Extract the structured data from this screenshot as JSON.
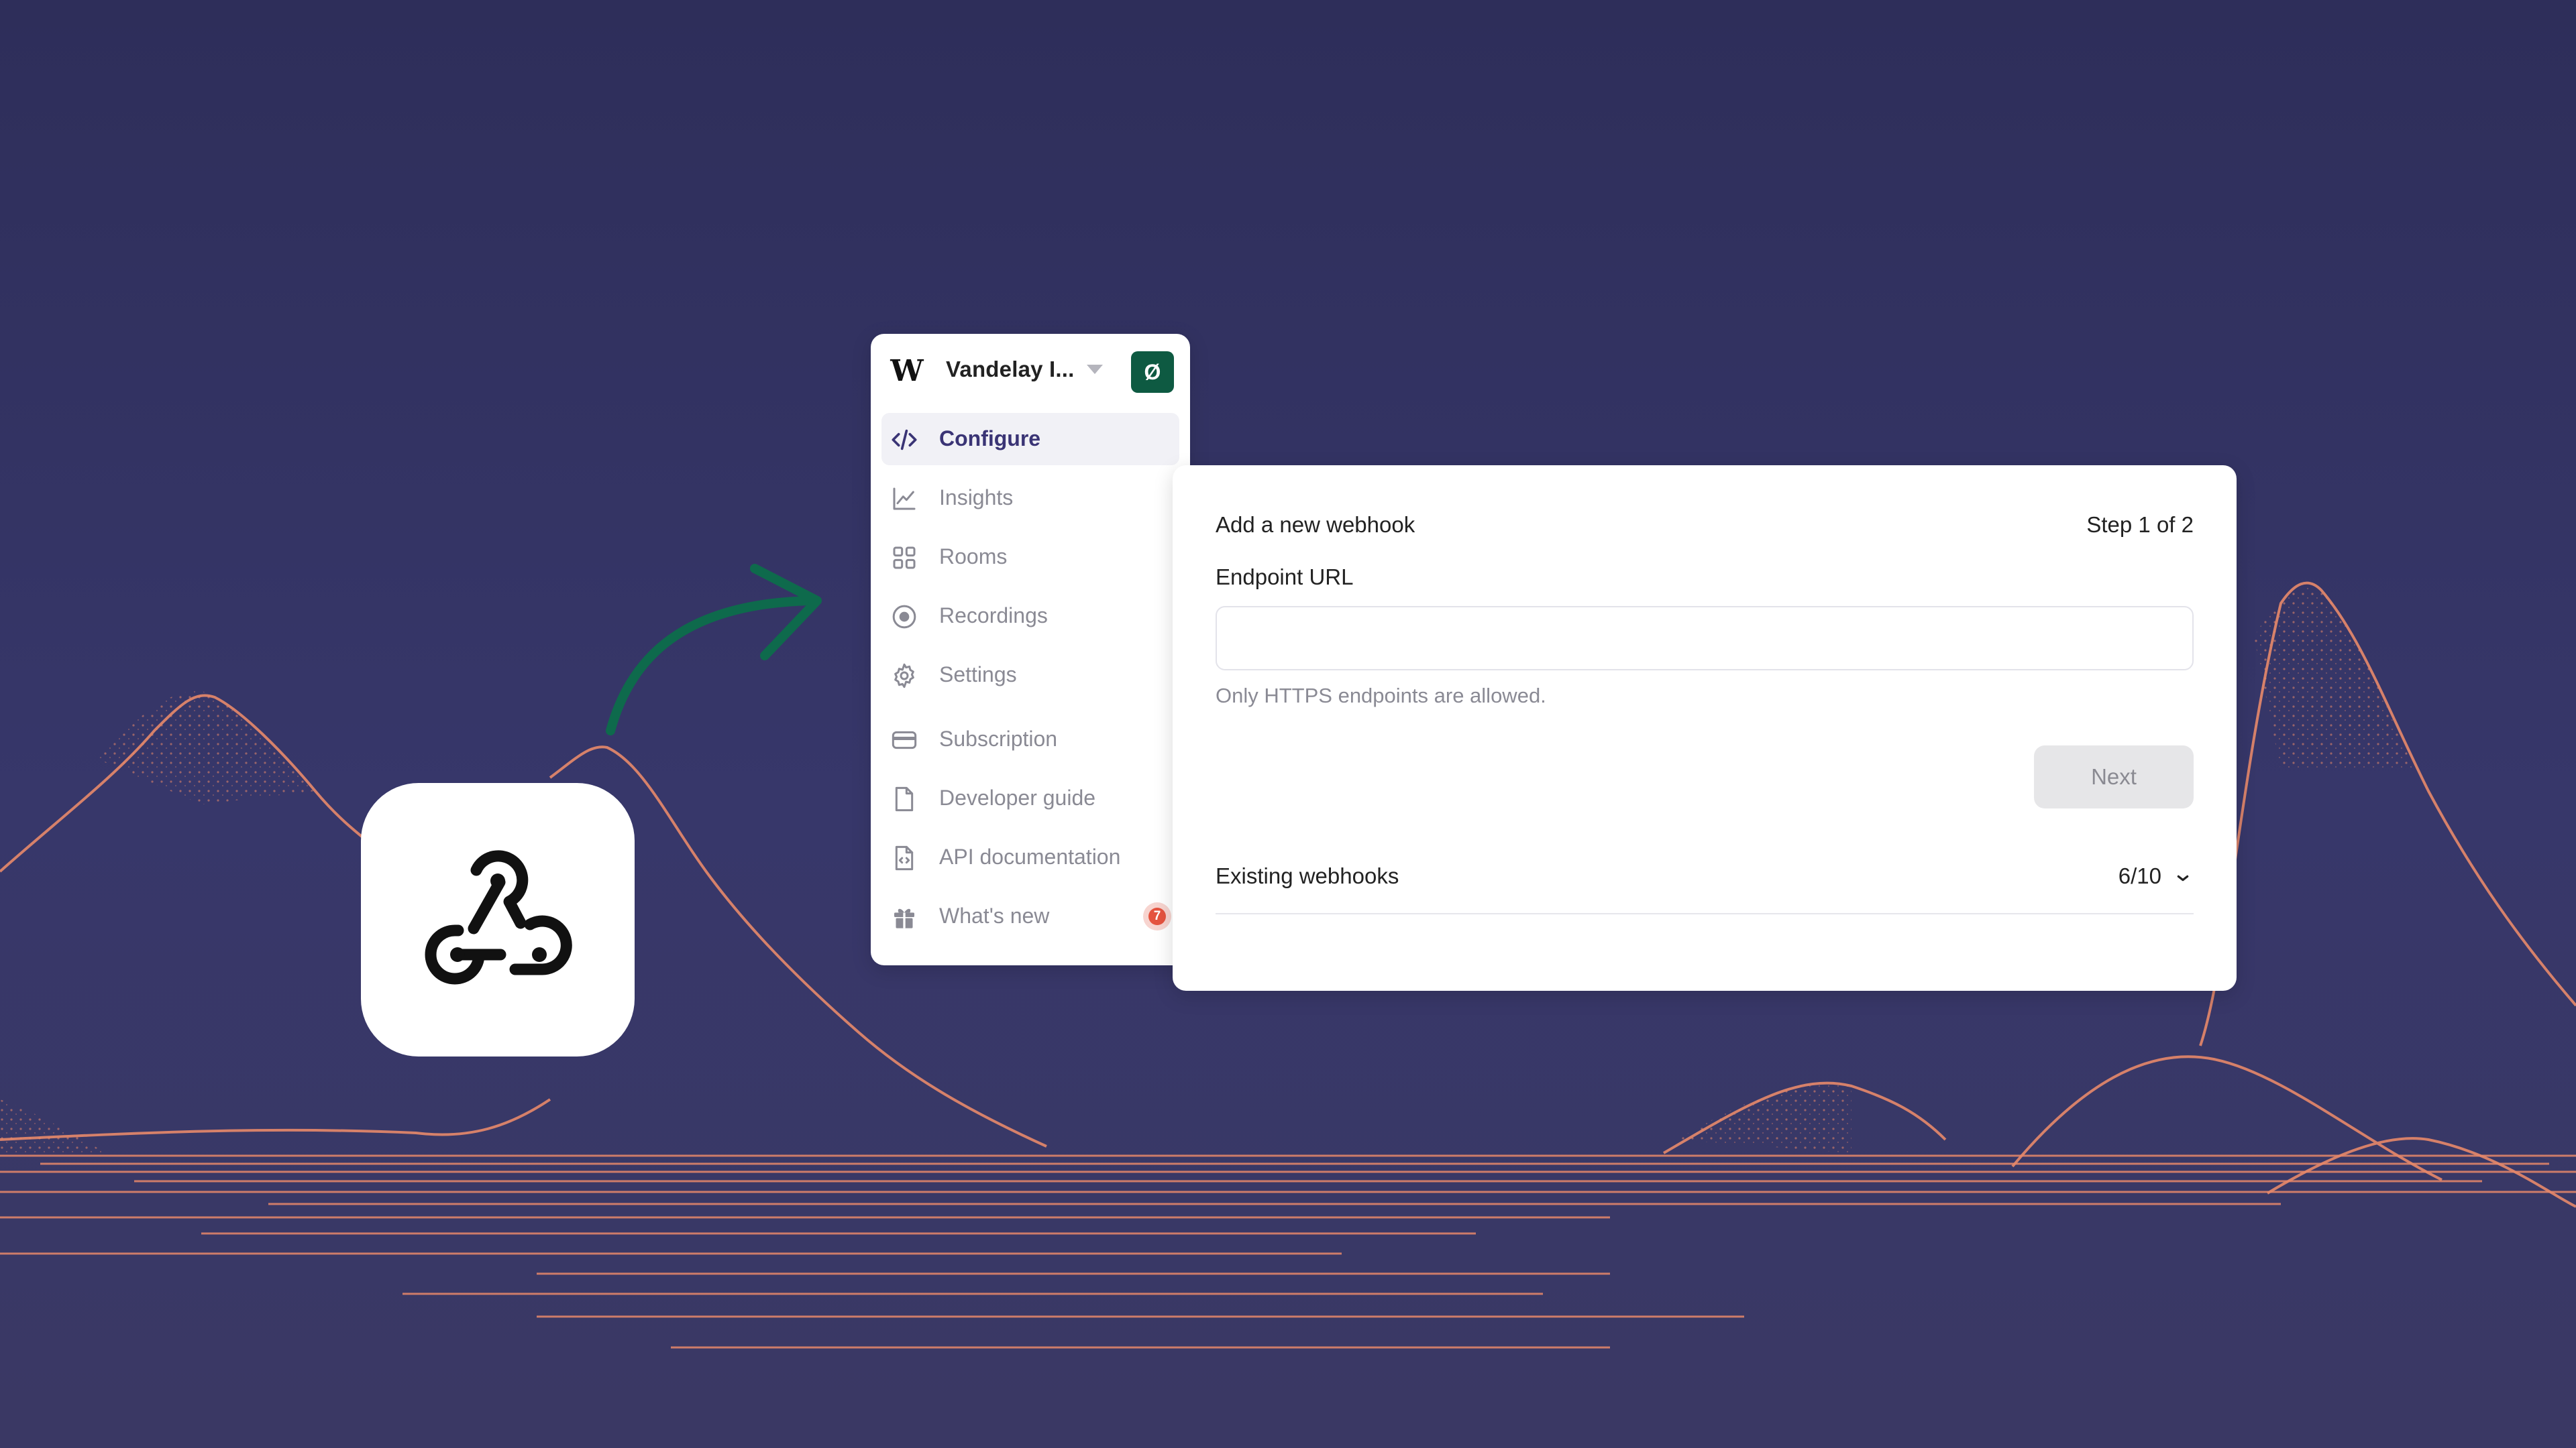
{
  "colors": {
    "background": "#34346a",
    "mountain_line": "#e8896a",
    "arrow": "#0e6a4c",
    "workspace_status_bg": "#0e5a42",
    "active_nav_text": "#3a3475",
    "badge": "#e5533f"
  },
  "webhook_tile": {
    "icon": "webhook-icon"
  },
  "sidebar": {
    "workspace_name": "Vandelay I...",
    "workspace_status": "Ø",
    "items": [
      {
        "label": "Configure",
        "icon": "code-icon",
        "active": true
      },
      {
        "label": "Insights",
        "icon": "chart-icon",
        "active": false
      },
      {
        "label": "Rooms",
        "icon": "grid-icon",
        "active": false
      },
      {
        "label": "Recordings",
        "icon": "record-icon",
        "active": false
      },
      {
        "label": "Settings",
        "icon": "gear-icon",
        "active": false
      },
      {
        "label": "Subscription",
        "icon": "card-icon",
        "active": false
      },
      {
        "label": "Developer guide",
        "icon": "document-icon",
        "active": false
      },
      {
        "label": "API documentation",
        "icon": "code-document-icon",
        "active": false
      },
      {
        "label": "What's new",
        "icon": "gift-icon",
        "active": false,
        "badge": "7"
      }
    ]
  },
  "panel": {
    "title": "Add a new webhook",
    "step": "Step 1 of 2",
    "endpoint_label": "Endpoint URL",
    "endpoint_value": "",
    "endpoint_placeholder": "",
    "helper_text": "Only HTTPS endpoints are allowed.",
    "next_label": "Next",
    "existing_label": "Existing webhooks",
    "existing_count": "6/10"
  }
}
